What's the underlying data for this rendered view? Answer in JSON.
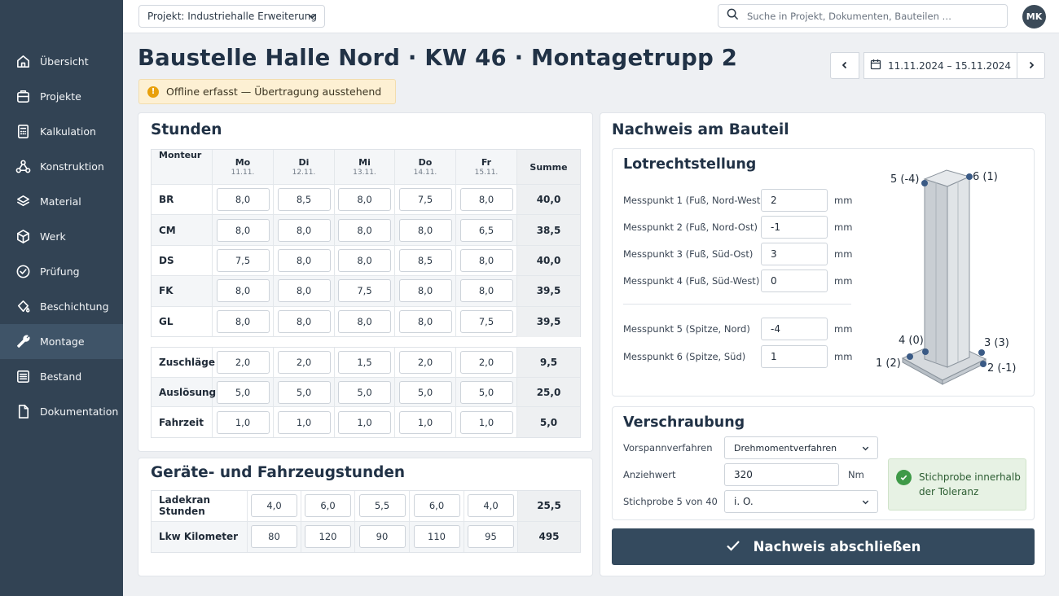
{
  "sidebar": {
    "items": [
      {
        "label": "Übersicht",
        "icon": "home-icon"
      },
      {
        "label": "Projekte",
        "icon": "briefcase-icon"
      },
      {
        "label": "Kalkulation",
        "icon": "calculator-icon"
      },
      {
        "label": "Konstruktion",
        "icon": "nodes-icon"
      },
      {
        "label": "Material",
        "icon": "layers-icon"
      },
      {
        "label": "Werk",
        "icon": "box-icon"
      },
      {
        "label": "Prüfung",
        "icon": "check-circle-icon"
      },
      {
        "label": "Beschichtung",
        "icon": "paint-drop-icon"
      },
      {
        "label": "Montage",
        "icon": "wrench-icon",
        "active": true
      },
      {
        "label": "Bestand",
        "icon": "list-icon"
      },
      {
        "label": "Dokumentation",
        "icon": "document-icon"
      }
    ]
  },
  "header": {
    "project": "Projekt: Industriehalle Erweiterung",
    "search_placeholder": "Suche in Projekt, Dokumenten, Bauteilen …",
    "avatar": "MK"
  },
  "page": {
    "title": "Baustelle Halle Nord · KW 46 · Montagetrupp 2",
    "date_range": "11.11.2024 – 15.11.2024",
    "alert": "Offline erfasst — Übertragung ausstehend"
  },
  "hours": {
    "title": "Stunden",
    "col_monteur": "Monteur",
    "col_sum": "Summe",
    "days": [
      {
        "day": "Mo",
        "date": "11.11."
      },
      {
        "day": "Di",
        "date": "12.11."
      },
      {
        "day": "Mi",
        "date": "13.11."
      },
      {
        "day": "Do",
        "date": "14.11."
      },
      {
        "day": "Fr",
        "date": "15.11."
      }
    ],
    "workers": [
      {
        "name": "BR",
        "values": [
          "8,0",
          "8,5",
          "8,0",
          "7,5",
          "8,0"
        ],
        "sum": "40,0"
      },
      {
        "name": "CM",
        "values": [
          "8,0",
          "8,0",
          "8,0",
          "8,0",
          "6,5"
        ],
        "sum": "38,5"
      },
      {
        "name": "DS",
        "values": [
          "7,5",
          "8,0",
          "8,0",
          "8,5",
          "8,0"
        ],
        "sum": "40,0"
      },
      {
        "name": "FK",
        "values": [
          "8,0",
          "8,0",
          "7,5",
          "8,0",
          "8,0"
        ],
        "sum": "39,5"
      },
      {
        "name": "GL",
        "values": [
          "8,0",
          "8,0",
          "8,0",
          "8,0",
          "7,5"
        ],
        "sum": "39,5"
      }
    ],
    "extras": [
      {
        "name": "Zuschläge",
        "values": [
          "2,0",
          "2,0",
          "1,5",
          "2,0",
          "2,0"
        ],
        "sum": "9,5"
      },
      {
        "name": "Auslösung",
        "values": [
          "5,0",
          "5,0",
          "5,0",
          "5,0",
          "5,0"
        ],
        "sum": "25,0"
      },
      {
        "name": "Fahrzeit",
        "values": [
          "1,0",
          "1,0",
          "1,0",
          "1,0",
          "1,0"
        ],
        "sum": "5,0"
      }
    ]
  },
  "equipment": {
    "title": "Geräte- und Fahrzeugstunden",
    "rows": [
      {
        "name": "Ladekran Stunden",
        "values": [
          "4,0",
          "6,0",
          "5,5",
          "6,0",
          "4,0"
        ],
        "sum": "25,5"
      },
      {
        "name": "Lkw Kilometer",
        "values": [
          "80",
          "120",
          "90",
          "110",
          "95"
        ],
        "sum": "495"
      }
    ]
  },
  "proof": {
    "title": "Nachweis am Bauteil",
    "plumb": {
      "title": "Lotrechtstellung",
      "unit": "mm",
      "points": [
        {
          "label": "Messpunkt 1 (Fuß, Nord-West)",
          "value": "2"
        },
        {
          "label": "Messpunkt 2 (Fuß, Nord-Ost)",
          "value": "-1"
        },
        {
          "label": "Messpunkt 3 (Fuß, Süd-Ost)",
          "value": "3"
        },
        {
          "label": "Messpunkt 4 (Fuß, Süd-West)",
          "value": "0"
        },
        {
          "label": "Messpunkt 5 (Spitze, Nord)",
          "value": "-4"
        },
        {
          "label": "Messpunkt 6 (Spitze, Süd)",
          "value": "1"
        }
      ],
      "diagram_labels": {
        "p5": "5 (-4)",
        "p6": "6 (1)",
        "p4": "4 (0)",
        "p3": "3 (3)",
        "p1": "1 (2)",
        "p2": "2 (-1)"
      }
    },
    "bolting": {
      "title": "Verschraubung",
      "method_label": "Vorspannverfahren",
      "method_value": "Drehmomentverfahren",
      "torque_label": "Anziehwert",
      "torque_value": "320",
      "torque_unit": "Nm",
      "sample_label": "Stichprobe 5 von 40",
      "sample_value": "i. O.",
      "status_text": "Stichprobe innerhalb der Toleranz"
    },
    "submit_label": "Nachweis abschließen"
  },
  "colors": {
    "sidebar": "#324354",
    "sidebar_active": "#3f5468",
    "primary": "#344a5e",
    "warning": "#e8a00c",
    "success": "#3f9a48"
  }
}
